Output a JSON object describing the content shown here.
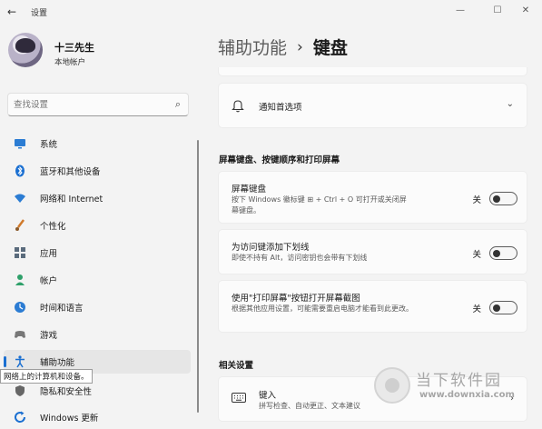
{
  "window": {
    "title": "设置",
    "controls": {
      "minimize": "—",
      "maximize": "☐",
      "close": "✕"
    }
  },
  "profile": {
    "name": "十三先生",
    "account_type": "本地帐户"
  },
  "search": {
    "placeholder": "查找设置",
    "value": ""
  },
  "sidebar": {
    "items": [
      {
        "label": "系统",
        "icon": "monitor-icon",
        "color": "#2b7cd3"
      },
      {
        "label": "蓝牙和其他设备",
        "icon": "bluetooth-icon",
        "color": "#1a6fd1"
      },
      {
        "label": "网络和 Internet",
        "icon": "wifi-icon",
        "color": "#2b7cd3"
      },
      {
        "label": "个性化",
        "icon": "brush-icon",
        "color": "#d07a2b"
      },
      {
        "label": "应用",
        "icon": "apps-icon",
        "color": "#5a6b7c"
      },
      {
        "label": "帐户",
        "icon": "person-icon",
        "color": "#2fa06a"
      },
      {
        "label": "时间和语言",
        "icon": "globe-clock-icon",
        "color": "#2b7cd3"
      },
      {
        "label": "游戏",
        "icon": "gamepad-icon",
        "color": "#777777"
      },
      {
        "label": "辅助功能",
        "icon": "accessibility-icon",
        "color": "#1a6fd1",
        "selected": true
      },
      {
        "label": "隐私和安全性",
        "icon": "shield-icon",
        "color": "#666666"
      },
      {
        "label": "Windows 更新",
        "icon": "update-icon",
        "color": "#1a6fd1"
      }
    ],
    "tooltip": "网络上的计算机和设备。"
  },
  "breadcrumb": {
    "parent": "辅助功能",
    "separator": "›",
    "current": "键盘"
  },
  "notifications_card": {
    "label": "通知首选项"
  },
  "section_onscreen": {
    "title": "屏幕键盘、按键顺序和打印屏幕",
    "items": [
      {
        "title": "屏幕键盘",
        "desc": "按下 Windows 徽标键 ⊞ + Ctrl + O 可打开或关闭屏幕键盘。",
        "state": "关"
      },
      {
        "title": "为访问键添加下划线",
        "desc": "即使不持有 Alt，访问密钥也会带有下划线",
        "state": "关"
      },
      {
        "title": "使用\"打印屏幕\"按钮打开屏幕截图",
        "desc": "根据其他应用设置，可能需要重启电脑才能看到此更改。",
        "state": "关"
      }
    ]
  },
  "section_related": {
    "title": "相关设置",
    "items": [
      {
        "title": "键入",
        "desc": "拼写检查、自动更正、文本建议"
      }
    ]
  },
  "watermark": {
    "text": "当下软件园",
    "url": "www.downxia.com"
  },
  "colors": {
    "accent": "#1a6fd1",
    "background": "#f3f3f3",
    "card": "#fbfbfb"
  }
}
